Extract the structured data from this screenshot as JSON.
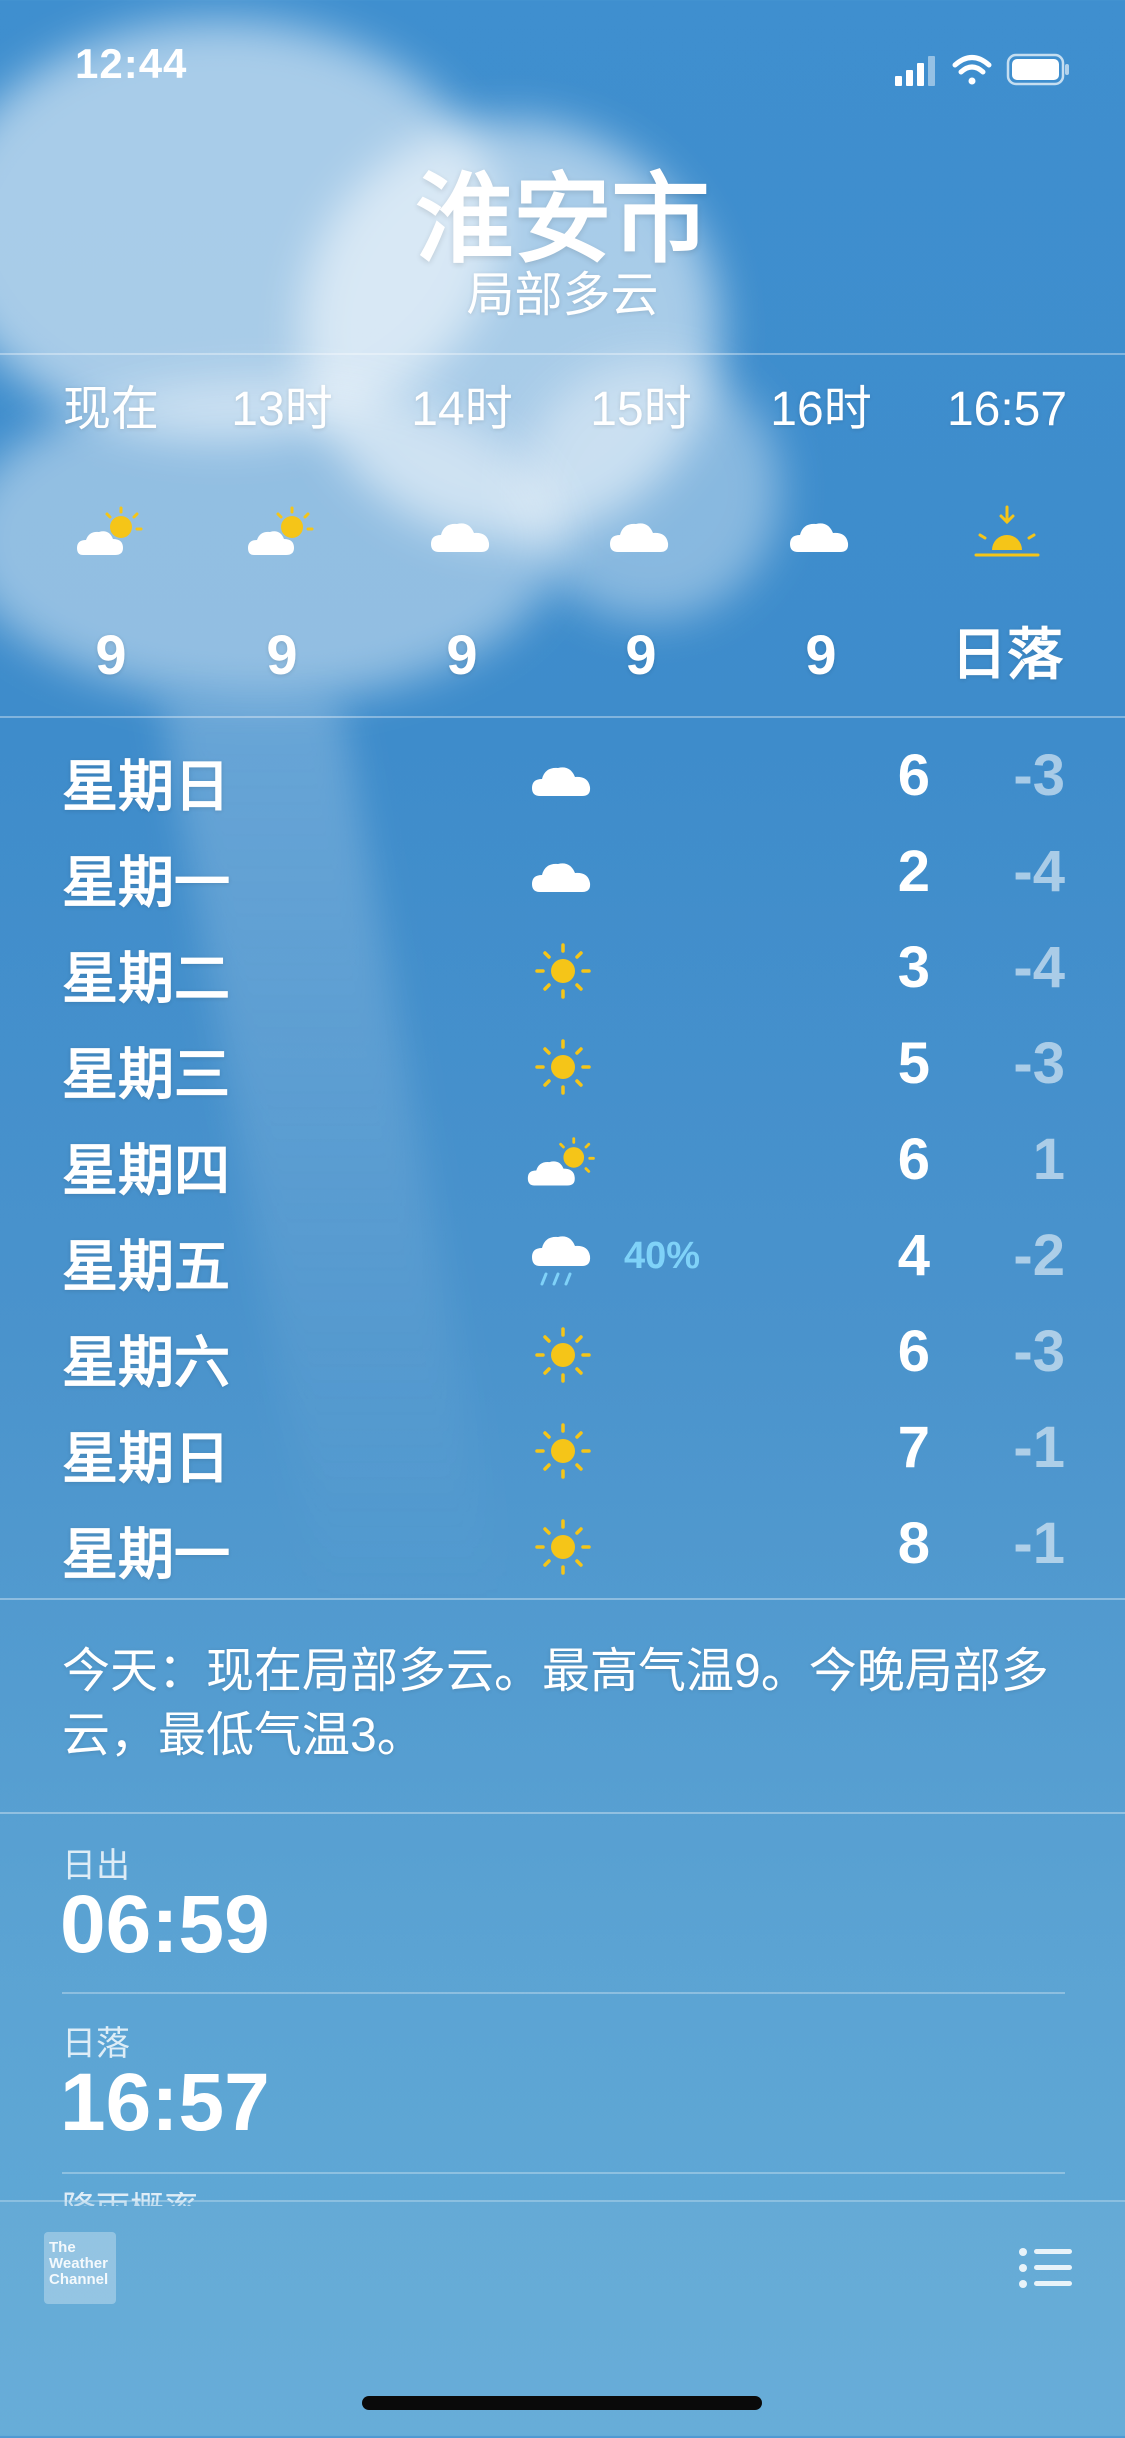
{
  "status_bar": {
    "time": "12:44"
  },
  "header": {
    "city": "淮安市",
    "condition": "局部多云"
  },
  "hourly": [
    {
      "label": "现在",
      "icon": "partly-sunny-icon",
      "value": "9"
    },
    {
      "label": "13时",
      "icon": "partly-sunny-icon",
      "value": "9"
    },
    {
      "label": "14时",
      "icon": "cloud-icon",
      "value": "9"
    },
    {
      "label": "15时",
      "icon": "cloud-icon",
      "value": "9"
    },
    {
      "label": "16时",
      "icon": "cloud-icon",
      "value": "9"
    },
    {
      "label": "16:57",
      "icon": "sunset-icon",
      "value": "日落"
    }
  ],
  "daily": [
    {
      "day": "星期日",
      "icon": "cloud-icon",
      "pop": "",
      "high": "6",
      "low": "-3"
    },
    {
      "day": "星期一",
      "icon": "cloud-icon",
      "pop": "",
      "high": "2",
      "low": "-4"
    },
    {
      "day": "星期二",
      "icon": "sun-icon",
      "pop": "",
      "high": "3",
      "low": "-4"
    },
    {
      "day": "星期三",
      "icon": "sun-icon",
      "pop": "",
      "high": "5",
      "low": "-3"
    },
    {
      "day": "星期四",
      "icon": "partly-cloudy-icon",
      "pop": "",
      "high": "6",
      "low": "1"
    },
    {
      "day": "星期五",
      "icon": "rain-icon",
      "pop": "40%",
      "high": "4",
      "low": "-2"
    },
    {
      "day": "星期六",
      "icon": "sun-icon",
      "pop": "",
      "high": "6",
      "low": "-3"
    },
    {
      "day": "星期日",
      "icon": "sun-icon",
      "pop": "",
      "high": "7",
      "low": "-1"
    },
    {
      "day": "星期一",
      "icon": "sun-icon",
      "pop": "",
      "high": "8",
      "low": "-1"
    }
  ],
  "summary": "今天：现在局部多云。最高气温9。今晚局部多云，最低气温3。",
  "details": {
    "sunrise_label": "日出",
    "sunrise_value": "06:59",
    "sunset_label": "日落",
    "sunset_value": "16:57",
    "next_label": "降雨概率"
  },
  "footer": {
    "logo_text": "The Weather Channel"
  },
  "colors": {
    "sun": "#f5c518",
    "precip": "#7fd2f8"
  }
}
